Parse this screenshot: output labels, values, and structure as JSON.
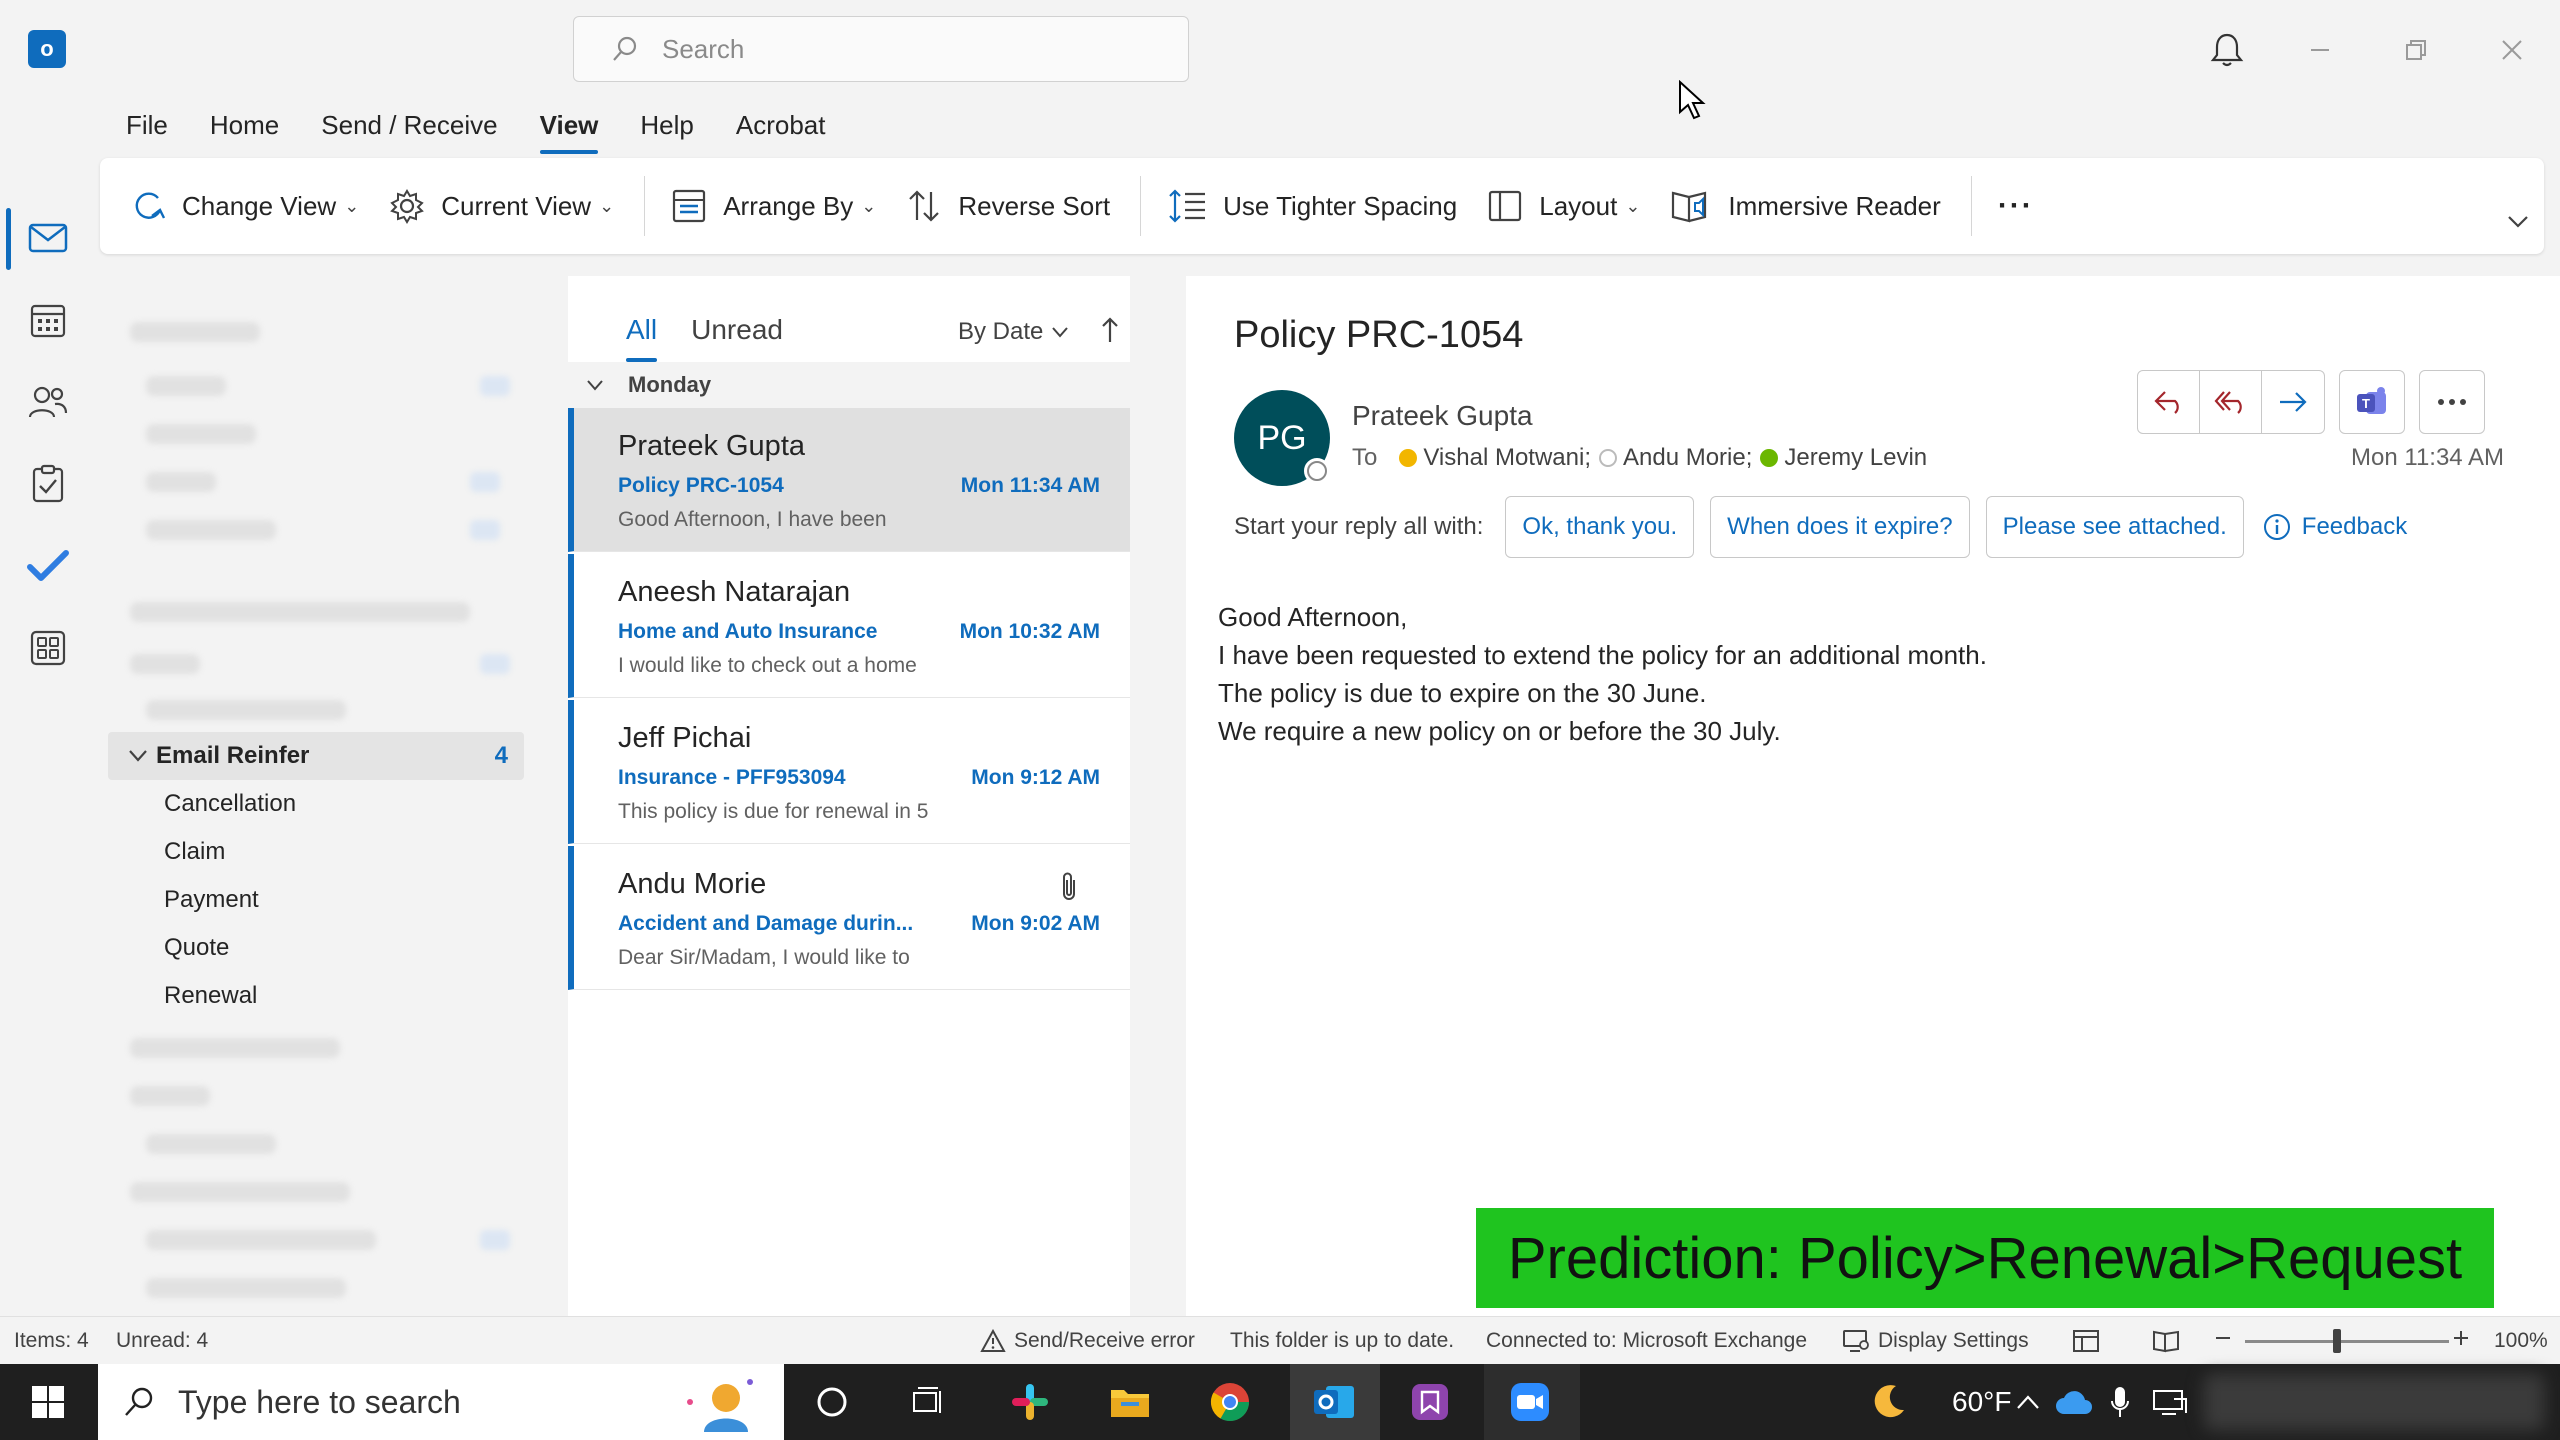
{
  "app": {
    "logo_letter": "o"
  },
  "search": {
    "placeholder": "Search"
  },
  "menu": [
    "File",
    "Home",
    "Send / Receive",
    "View",
    "Help",
    "Acrobat"
  ],
  "menu_active": "View",
  "ribbon": {
    "change_view": "Change View",
    "current_view": "Current View",
    "arrange_by": "Arrange By",
    "reverse_sort": "Reverse Sort",
    "tighter_spacing": "Use Tighter Spacing",
    "layout": "Layout",
    "immersive_reader": "Immersive Reader",
    "more": "···"
  },
  "folders": {
    "group": {
      "name": "Email Reinfer",
      "count": "4"
    },
    "subfolders": [
      "Cancellation",
      "Claim",
      "Payment",
      "Quote",
      "Renewal"
    ]
  },
  "message_list": {
    "tabs": [
      "All",
      "Unread"
    ],
    "active_tab": "All",
    "sort_label": "By Date",
    "group_label": "Monday",
    "messages": [
      {
        "from": "Prateek Gupta",
        "subject": "Policy PRC-1054",
        "time": "Mon 11:34 AM",
        "preview": "Good Afternoon,  I have been",
        "selected": true,
        "attachment": false
      },
      {
        "from": "Aneesh Natarajan",
        "subject": "Home and Auto Insurance",
        "time": "Mon 10:32 AM",
        "preview": "I would like to check out a home",
        "selected": false,
        "attachment": false
      },
      {
        "from": "Jeff Pichai",
        "subject": "Insurance - PFF953094",
        "time": "Mon 9:12 AM",
        "preview": "This policy is due for renewal in 5",
        "selected": false,
        "attachment": false
      },
      {
        "from": "Andu Morie",
        "subject": "Accident and Damage durin...",
        "time": "Mon 9:02 AM",
        "preview": "Dear Sir/Madam,  I would like to",
        "selected": false,
        "attachment": true
      }
    ]
  },
  "reading": {
    "subject": "Policy PRC-1054",
    "avatar_initials": "PG",
    "sender": "Prateek Gupta",
    "to_label": "To",
    "recipients": [
      {
        "name": "Vishal Motwani;",
        "status_color": "#f2b600"
      },
      {
        "name": "Andu Morie;",
        "status_color": "#ffffff"
      },
      {
        "name": "Jeremy Levin",
        "status_color": "#6bb700"
      }
    ],
    "time": "Mon 11:34 AM",
    "reply_prompt": "Start your reply all with:",
    "suggestions": [
      "Ok, thank you.",
      "When does it expire?",
      "Please see attached."
    ],
    "feedback": "Feedback",
    "body": [
      "Good Afternoon,",
      "I have been requested to extend the policy for an additional month.",
      "The policy is due to expire on the 30 June.",
      "We require a new policy on or before the 30 July."
    ]
  },
  "prediction": "Prediction: Policy>Renewal>Request",
  "status": {
    "items": "Items: 4",
    "unread": "Unread: 4",
    "send_error": "Send/Receive error",
    "up_to_date": "This folder is up to date.",
    "connected": "Connected to: Microsoft Exchange",
    "display_settings": "Display Settings",
    "zoom": "100%",
    "zoom_level_fraction": 0.45
  },
  "taskbar": {
    "search_placeholder": "Type here to search",
    "temperature": "60°F"
  },
  "colors": {
    "accent": "#0f6cbd",
    "prediction_bg": "#1fc41f",
    "avatar_bg": "#004e5a"
  }
}
